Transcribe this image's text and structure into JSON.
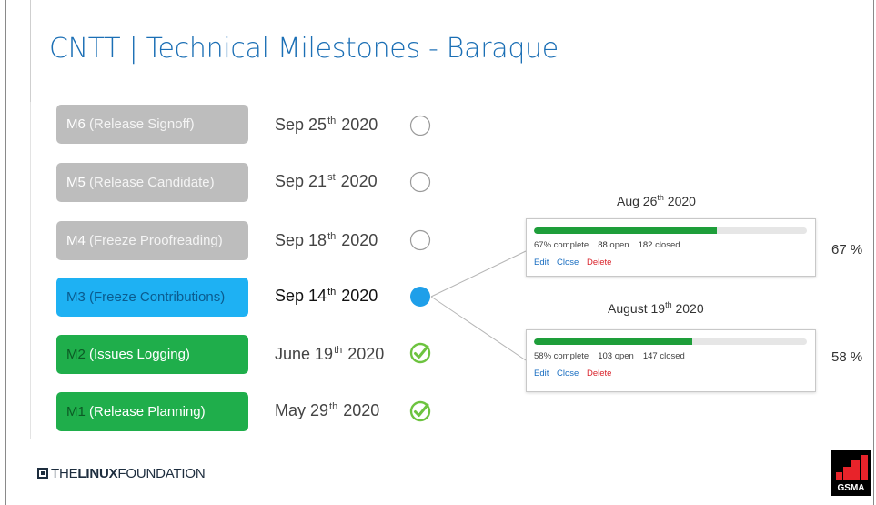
{
  "title": {
    "brand": "CNTT",
    "separator": "|",
    "rest": "Technical Milestones - Baraque"
  },
  "milestones": [
    {
      "code": "M6",
      "desc": "(Release Signoff)",
      "date_day": "Sep 25",
      "date_sup": "th",
      "date_year": "2020",
      "status": "pending"
    },
    {
      "code": "M5",
      "desc": "(Release Candidate)",
      "date_day": "Sep 21",
      "date_sup": "st",
      "date_year": "2020",
      "status": "pending"
    },
    {
      "code": "M4",
      "desc": "(Freeze Proofreading)",
      "date_day": "Sep 18",
      "date_sup": "th",
      "date_year": "2020",
      "status": "pending"
    },
    {
      "code": "M3",
      "desc": "(Freeze Contributions)",
      "date_day": "Sep 14",
      "date_sup": "th",
      "date_year": "2020",
      "status": "current"
    },
    {
      "code": "M2",
      "desc": "(Issues Logging)",
      "date_day": "June 19",
      "date_sup": "th",
      "date_year": "2020",
      "status": "done"
    },
    {
      "code": "M1",
      "desc": "(Release Planning)",
      "date_day": "May 29",
      "date_sup": "th",
      "date_year": "2020",
      "status": "done"
    }
  ],
  "progress_cards": [
    {
      "date_day": "Aug 26",
      "date_sup": "th",
      "date_year": "2020",
      "progress": 0.67,
      "complete_label": "67% complete",
      "open_count": "88",
      "open_label": "open",
      "closed_count": "182",
      "closed_label": "closed",
      "percent_label": "67 %",
      "actions": {
        "edit": "Edit",
        "close": "Close",
        "delete": "Delete"
      }
    },
    {
      "date_day": "August 19",
      "date_sup": "th",
      "date_year": "2020",
      "progress": 0.58,
      "complete_label": "58% complete",
      "open_count": "103",
      "open_label": "open",
      "closed_count": "147",
      "closed_label": "closed",
      "percent_label": "58 %",
      "actions": {
        "edit": "Edit",
        "close": "Close",
        "delete": "Delete"
      }
    }
  ],
  "footer": {
    "logo_the": "THE",
    "logo_linux": "LINUX",
    "logo_foundation": "FOUNDATION",
    "gsma": "GSMA"
  },
  "colors": {
    "title": "#1b6fb5",
    "grey": "#bdbdbd",
    "blue": "#1eb1f3",
    "green": "#1fae4b",
    "progress": "#1e9e3a",
    "check": "#6dc33f"
  }
}
